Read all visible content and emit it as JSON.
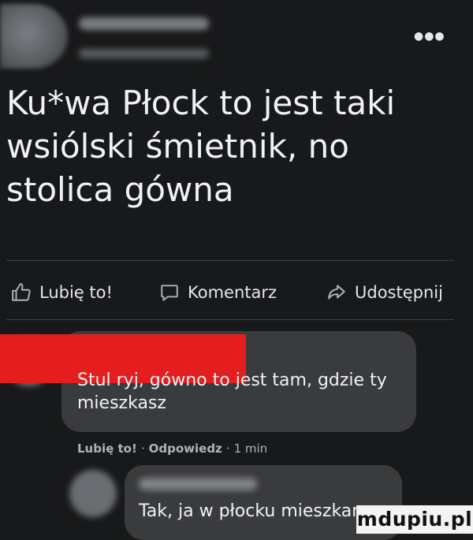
{
  "post": {
    "text": "Ku*wa Płock to jest taki wsiólski śmietnik, no stolica gówna",
    "more_icon": "more-horizontal-icon"
  },
  "actions": {
    "like_label": "Lubię to!",
    "comment_label": "Komentarz",
    "share_label": "Udostępnij"
  },
  "comments": [
    {
      "text": "Stul ryj, gówno to jest tam, gdzie ty mieszkasz",
      "like_label": "Lubię to!",
      "reply_label": "Odpowiedz",
      "time": "1 min"
    },
    {
      "text": "Tak, ja w płocku mieszkam"
    }
  ],
  "watermark": "mdupiu.pl",
  "colors": {
    "background": "#18191a",
    "bubble": "#3a3b3c",
    "redaction": "#e41e1e"
  }
}
